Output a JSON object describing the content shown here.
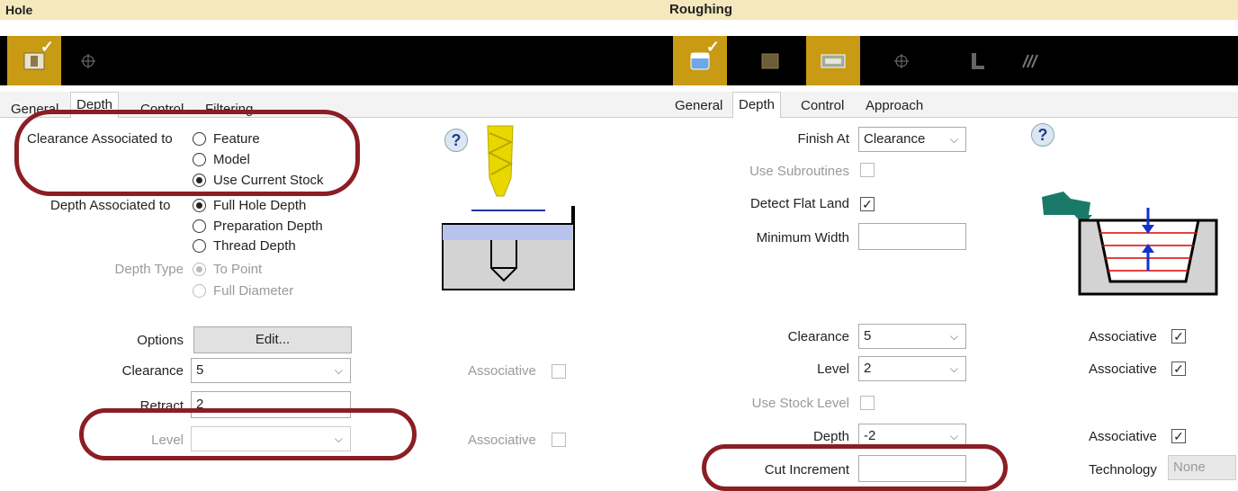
{
  "hole": {
    "title": "Hole",
    "tabs": [
      "General",
      "Depth",
      "Control",
      "Filtering"
    ],
    "clearance_assoc_label": "Clearance Associated to",
    "clearance_options": [
      "Feature",
      "Model",
      "Use Current Stock"
    ],
    "depth_assoc_label": "Depth Associated to",
    "depth_options": [
      "Full Hole Depth",
      "Preparation Depth",
      "Thread Depth"
    ],
    "depth_type_label": "Depth Type",
    "depth_type_options": [
      "To Point",
      "Full Diameter"
    ],
    "options_label": "Options",
    "edit_button": "Edit...",
    "clearance_label": "Clearance",
    "clearance_value": "5",
    "retract_label": "Retract",
    "retract_value": "2",
    "level_label": "Level",
    "associative_label": "Associative",
    "help_icon": "?"
  },
  "roughing": {
    "title": "Roughing",
    "tabs": [
      "General",
      "Depth",
      "Control",
      "Approach"
    ],
    "finish_at_label": "Finish At",
    "finish_at_value": "Clearance",
    "use_subroutines_label": "Use Subroutines",
    "detect_flat_land_label": "Detect Flat Land",
    "minimum_width_label": "Minimum Width",
    "clearance_label": "Clearance",
    "clearance_value": "5",
    "level_label": "Level",
    "level_value": "2",
    "use_stock_level_label": "Use Stock Level",
    "depth_label": "Depth",
    "depth_value": "-2",
    "cut_increment_label": "Cut Increment",
    "associative_label": "Associative",
    "technology_label": "Technology",
    "technology_value": "None",
    "check_mark": "✓",
    "help_icon": "?"
  },
  "colors": {
    "title_bg": "#f4e8bc",
    "toolbar_active": "#c99a14",
    "highlight_oval": "#8b1e24"
  }
}
